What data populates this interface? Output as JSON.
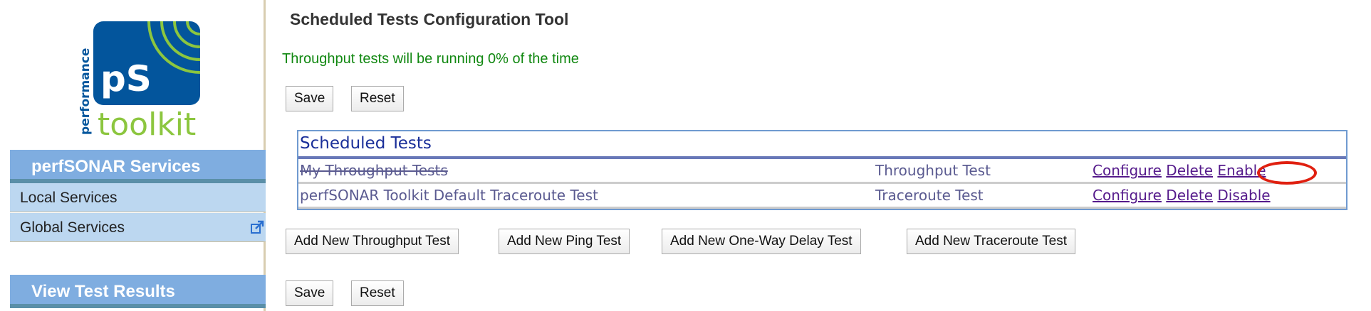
{
  "sidebar": {
    "logo": {
      "side_text": "performance",
      "mark": "pS",
      "word": "toolkit"
    },
    "sections": [
      {
        "title": "perfSONAR Services",
        "items": [
          {
            "label": "Local Services"
          },
          {
            "label": "Global Services",
            "icon": "external-link-icon"
          }
        ]
      },
      {
        "title": "View Test Results"
      }
    ]
  },
  "main": {
    "title": "Scheduled Tests Configuration Tool",
    "status": "Throughput tests will be running 0% of the time",
    "save_label": "Save",
    "reset_label": "Reset",
    "table": {
      "title": "Scheduled Tests",
      "rows": [
        {
          "name": "My Throughput Tests",
          "type": "Throughput Test",
          "configure": "Configure",
          "delete": "Delete",
          "toggle": "Enable",
          "disabled": true
        },
        {
          "name": "perfSONAR Toolkit Default Traceroute Test",
          "type": "Traceroute Test",
          "configure": "Configure",
          "delete": "Delete",
          "toggle": "Disable",
          "disabled": false
        }
      ]
    },
    "add_buttons": [
      "Add New Throughput Test",
      "Add New Ping Test",
      "Add New One-Way Delay Test",
      "Add New Traceroute Test"
    ],
    "colors": {
      "status": "#118811",
      "highlight": "#e02010",
      "sidebar_header": "#7fade0"
    }
  }
}
